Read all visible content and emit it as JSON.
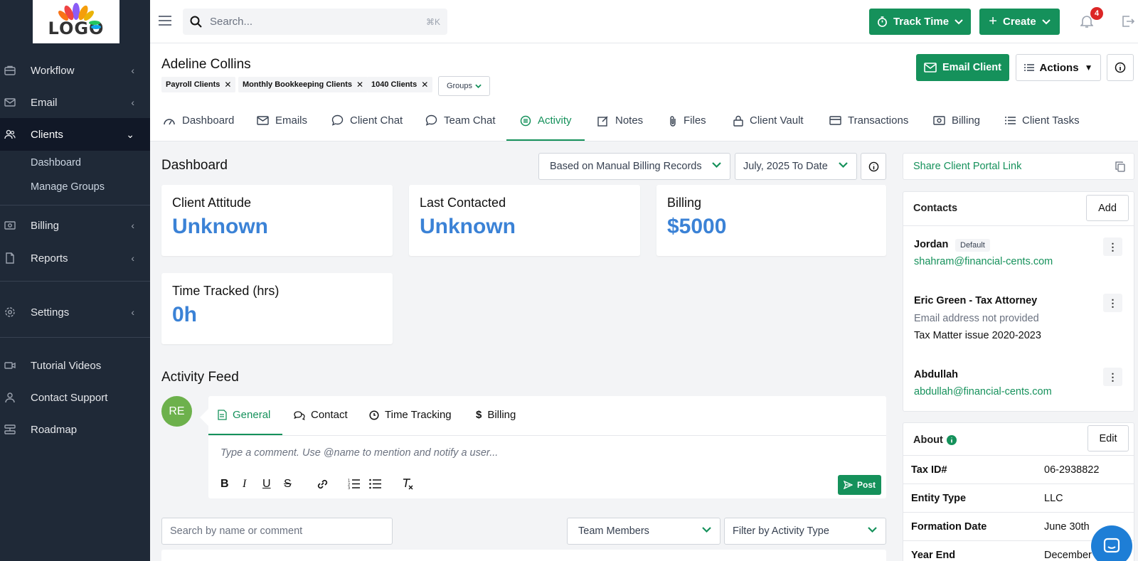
{
  "logo": {
    "text": "LOGO"
  },
  "sidebar": {
    "items": [
      {
        "label": "Workflow",
        "icon": "briefcase-icon",
        "chev": "‹"
      },
      {
        "label": "Email",
        "icon": "mail-icon",
        "chev": "‹"
      },
      {
        "label": "Clients",
        "icon": "users-icon",
        "chev": "⌄"
      },
      {
        "label": "Billing",
        "icon": "money-icon",
        "chev": "‹"
      },
      {
        "label": "Reports",
        "icon": "document-icon",
        "chev": "‹"
      },
      {
        "label": "Settings",
        "icon": "gear-icon",
        "chev": "‹"
      },
      {
        "label": "Tutorial Videos",
        "icon": "video-icon"
      },
      {
        "label": "Contact Support",
        "icon": "user-icon"
      },
      {
        "label": "Roadmap",
        "icon": "roadmap-icon"
      }
    ],
    "sub_items": [
      "Dashboard",
      "Manage Groups"
    ]
  },
  "topbar": {
    "search_placeholder": "Search...",
    "search_shortcut": "⌘K",
    "track_time_label": "Track Time",
    "create_label": "Create",
    "notification_count": "4"
  },
  "client": {
    "name": "Adeline Collins",
    "tags": [
      "Payroll Clients",
      "Monthly Bookkeeping Clients",
      "1040 Clients"
    ],
    "groups_label": "Groups",
    "email_client_label": "Email Client",
    "actions_label": "Actions"
  },
  "tabs": [
    "Dashboard",
    "Emails",
    "Client Chat",
    "Team Chat",
    "Activity",
    "Notes",
    "Files",
    "Client Vault",
    "Transactions",
    "Billing",
    "Client Tasks"
  ],
  "dashboard": {
    "title": "Dashboard",
    "billing_basis": "Based on Manual Billing Records",
    "date_range": "July, 2025 To Date",
    "cards": [
      {
        "title": "Client Attitude",
        "value": "Unknown"
      },
      {
        "title": "Last Contacted",
        "value": "Unknown"
      },
      {
        "title": "Billing",
        "value": "$5000"
      },
      {
        "title": "Time Tracked (hrs)",
        "value": "0h"
      }
    ]
  },
  "activity": {
    "title": "Activity Feed",
    "avatar_initials": "RE",
    "composer_tabs": [
      "General",
      "Contact",
      "Time Tracking",
      "Billing"
    ],
    "comment_placeholder": "Type a comment. Use @name to mention and notify a user...",
    "format_buttons": [
      "B",
      "I",
      "U",
      "S"
    ],
    "post_label": "Post",
    "search_placeholder": "Search by name or comment",
    "team_members_label": "Team Members",
    "filter_label": "Filter by Activity Type"
  },
  "right_panel": {
    "share_link_label": "Share Client Portal Link",
    "contacts_title": "Contacts",
    "add_label": "Add",
    "contacts": [
      {
        "name": "Jordan",
        "badge": "Default",
        "email": "shahram@financial-cents.com"
      },
      {
        "name": "Eric Green - Tax Attorney",
        "note": "Email address not provided",
        "note2": "Tax Matter issue 2020-2023"
      },
      {
        "name": "Abdullah",
        "email": "abdullah@financial-cents.com"
      }
    ],
    "about_title": "About",
    "edit_label": "Edit",
    "about_rows": [
      {
        "key": "Tax ID#",
        "value": "06-2938822"
      },
      {
        "key": "Entity Type",
        "value": "LLC"
      },
      {
        "key": "Formation Date",
        "value": "June 30th"
      },
      {
        "key": "Year End",
        "value": "December"
      }
    ]
  },
  "colors": {
    "accent": "#15915b",
    "sidebar": "#1f2937",
    "value_blue": "#3b82d6"
  }
}
